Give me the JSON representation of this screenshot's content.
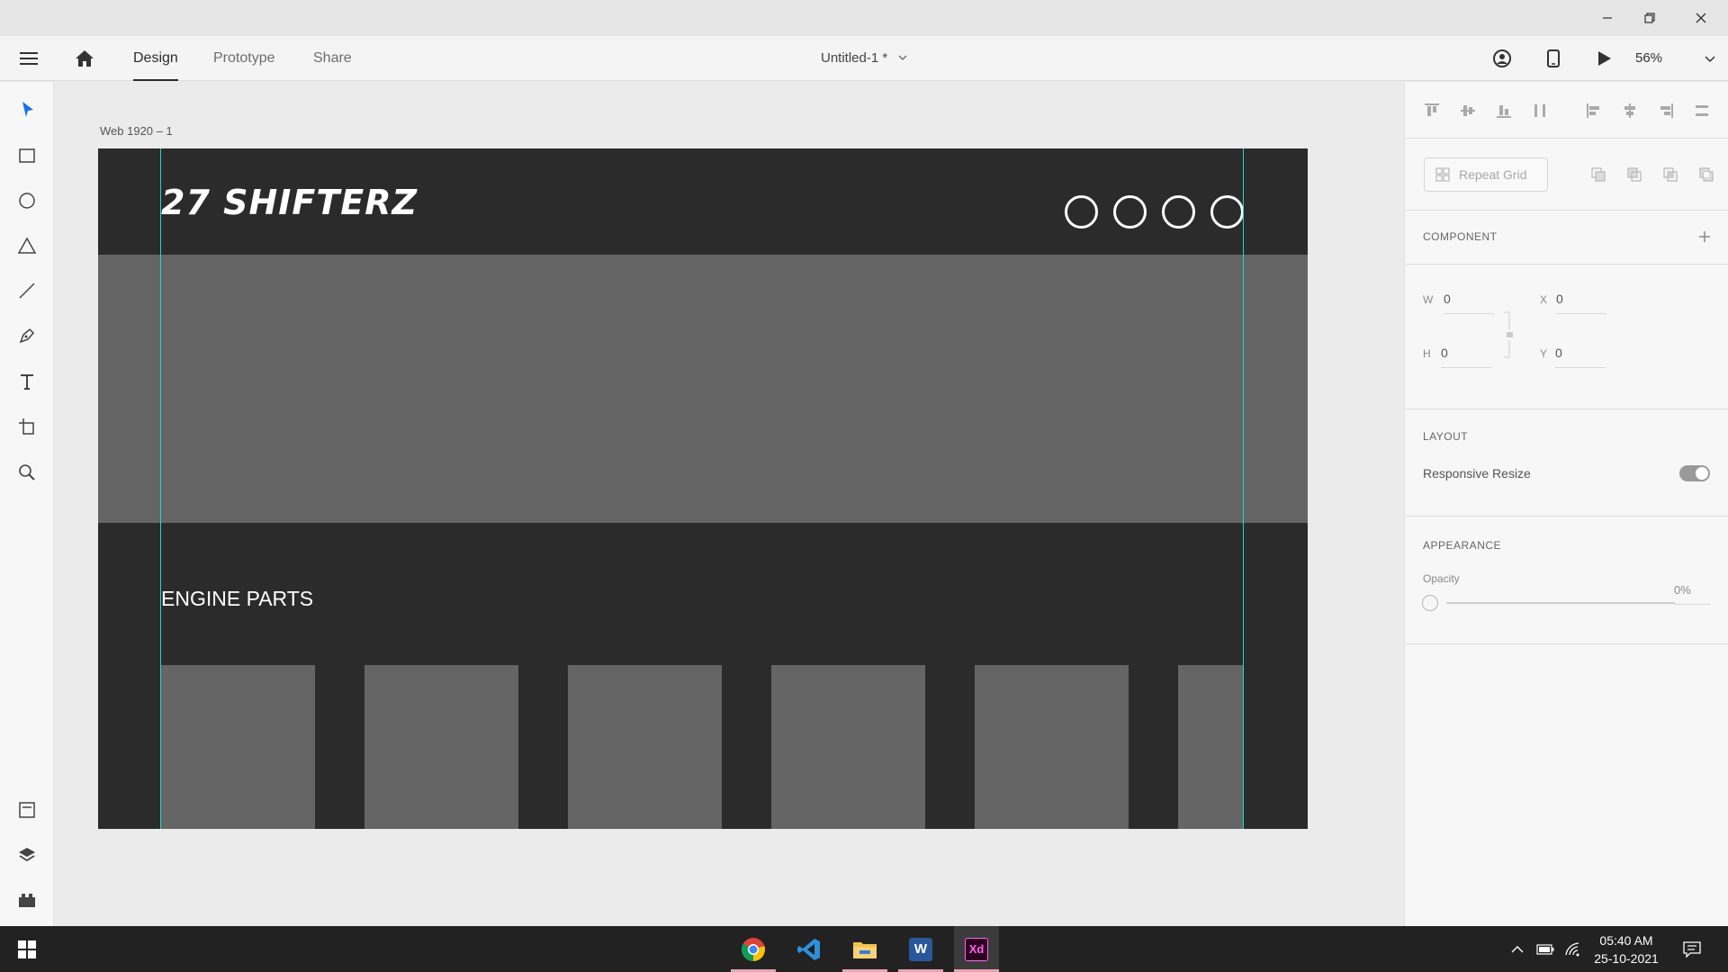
{
  "window": {
    "minimize_icon": "minimize-icon",
    "restore_icon": "restore-icon",
    "close_icon": "close-icon"
  },
  "appbar": {
    "tabs": [
      {
        "label": "Design",
        "active": true
      },
      {
        "label": "Prototype",
        "active": false
      },
      {
        "label": "Share",
        "active": false
      }
    ],
    "document_title": "Untitled-1 *",
    "zoom": "56%"
  },
  "canvas": {
    "artboard_name": "Web 1920 – 1",
    "brand": "27 SHIFTERZ",
    "section_title": "ENGINE PARTS",
    "colors": {
      "artboard": "#2b2b2b",
      "placeholder": "#656565",
      "guide": "#22d4d4"
    }
  },
  "panel": {
    "repeat_grid": "Repeat Grid",
    "component_heading": "COMPONENT",
    "w_label": "W",
    "w_value": "0",
    "h_label": "H",
    "h_value": "0",
    "x_label": "X",
    "x_value": "0",
    "y_label": "Y",
    "y_value": "0",
    "layout_heading": "LAYOUT",
    "responsive_resize": "Responsive Resize",
    "responsive_resize_on": true,
    "appearance_heading": "APPEARANCE",
    "opacity_label": "Opacity",
    "opacity_value": "0%"
  },
  "taskbar": {
    "apps": [
      "chrome",
      "vscode",
      "file-explorer",
      "word",
      "adobe-xd"
    ],
    "xd_label": "Xd",
    "word_label": "W",
    "time": "05:40 AM",
    "date": "25-10-2021"
  }
}
